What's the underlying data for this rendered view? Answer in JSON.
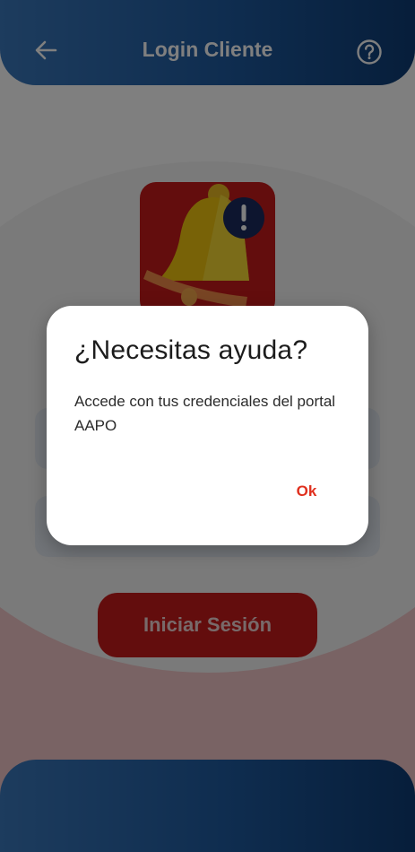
{
  "header": {
    "title": "Login Cliente",
    "back_icon": "arrow-left-icon",
    "help_icon": "question-circle-icon"
  },
  "logo": {
    "icon": "bell-alert-icon"
  },
  "form": {
    "submit_label": "Iniciar Sesión"
  },
  "dialog": {
    "title": "¿Necesitas ayuda?",
    "body": "Accede con tus credenciales del portal AAPO",
    "ok_label": "Ok"
  },
  "colors": {
    "header_gradient_start": "#3a78bc",
    "header_gradient_end": "#0e3c75",
    "brand_red": "#c61a1a",
    "dialog_action": "#e0301e",
    "bell_yellow": "#f1c40f"
  }
}
